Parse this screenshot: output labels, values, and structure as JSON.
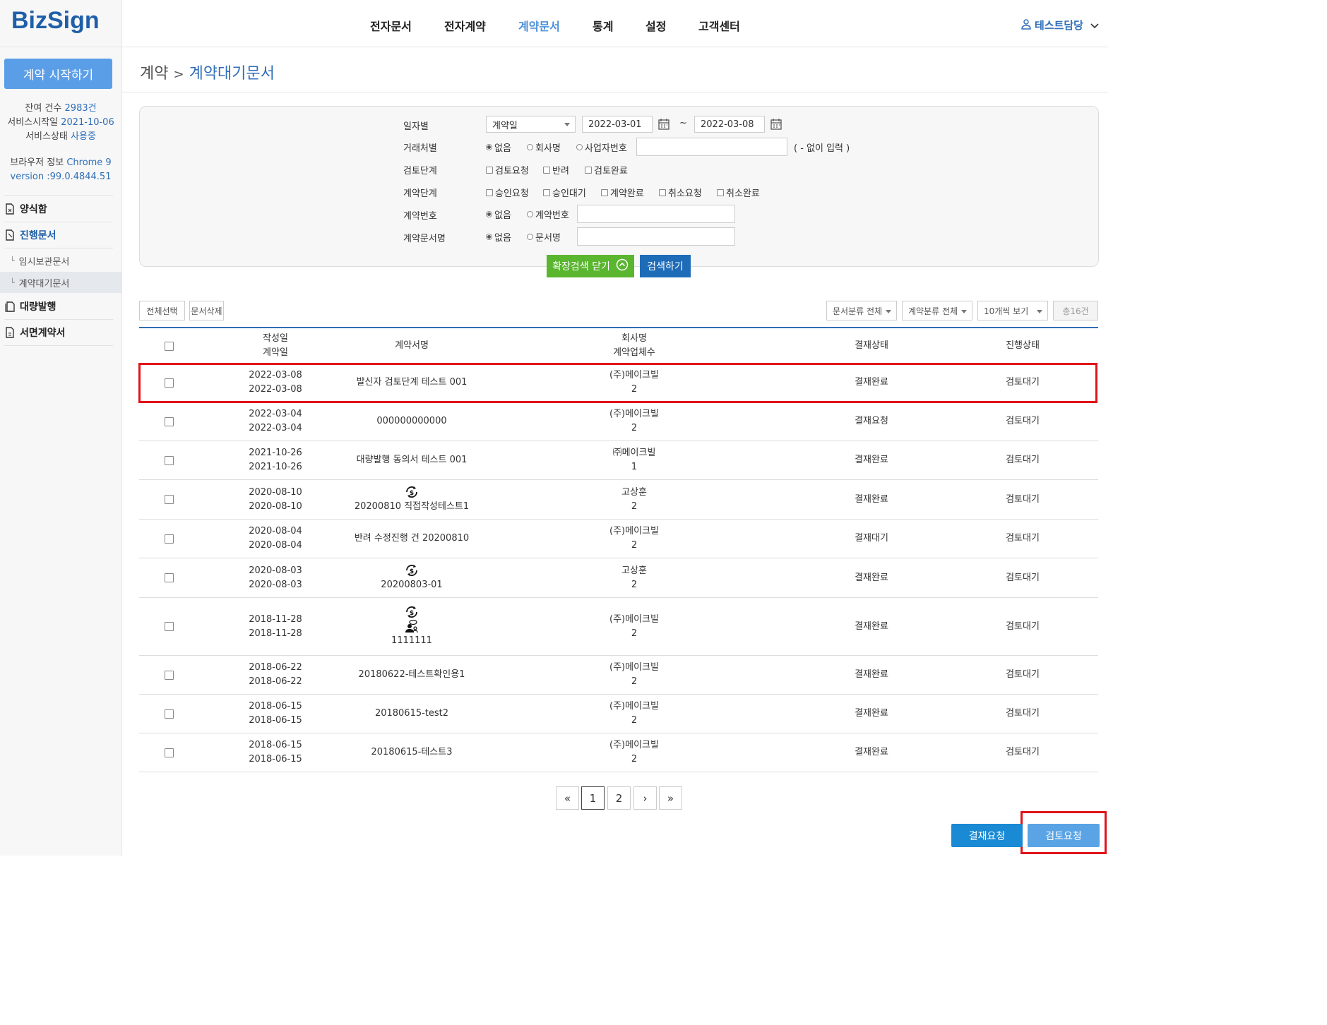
{
  "app": {
    "logo": "BizSign"
  },
  "topnav": {
    "items": [
      "전자문서",
      "전자계약",
      "계약문서",
      "통계",
      "설정",
      "고객센터"
    ],
    "active": "계약문서",
    "user": "테스트담당"
  },
  "sidebar": {
    "start_button": "계약 시작하기",
    "remaining_label": "잔여 건수",
    "remaining_value": "2983건",
    "service_start_label": "서비스시작일",
    "service_start_value": "2021-10-06",
    "service_status_label": "서비스상태",
    "service_status_value": "사용중",
    "browser_label": "브라우저 정보",
    "browser_value": "Chrome 9",
    "version_label": "version :",
    "version_value": "99.0.4844.51",
    "nav": [
      {
        "label": "양식함"
      },
      {
        "label": "진행문서"
      },
      {
        "label": "임시보관문서"
      },
      {
        "label": "계약대기문서"
      },
      {
        "label": "대량발행"
      },
      {
        "label": "서면계약서"
      }
    ]
  },
  "page": {
    "breadcrumb_parent": "계약",
    "breadcrumb_sep": ">",
    "breadcrumb_current": "계약대기문서"
  },
  "search": {
    "date_label": "일자별",
    "date_type": "계약일",
    "date_from": "2022-03-01",
    "date_tilde": "~",
    "date_to": "2022-03-08",
    "partner_label": "거래처별",
    "partner_options": [
      "없음",
      "회사명",
      "사업자번호"
    ],
    "partner_hint": "( - 없이 입력 )",
    "review_label": "검토단계",
    "review_options": [
      "검토요청",
      "반려",
      "검토완료"
    ],
    "contract_label": "계약단계",
    "contract_options": [
      "승인요청",
      "승인대기",
      "계약완료",
      "취소요청",
      "취소완료"
    ],
    "number_label": "계약번호",
    "number_options": [
      "없음",
      "계약번호"
    ],
    "docname_label": "계약문서명",
    "docname_options": [
      "없음",
      "문서명"
    ],
    "collapse_button": "확장검색 닫기",
    "search_button": "검색하기"
  },
  "toolbar": {
    "select_all": "전체선택",
    "delete": "문서삭제",
    "doc_type": "문서분류 전체",
    "contract_type": "계약분류 전체",
    "per_page": "10개씩 보기",
    "total": "총16건"
  },
  "table": {
    "headers": {
      "date1": "작성일",
      "date2": "계약일",
      "name": "계약서명",
      "company1": "회사명",
      "company2": "계약업체수",
      "approval": "결재상태",
      "progress": "진행상태"
    },
    "rows": [
      {
        "created": "2022-03-08",
        "contracted": "2022-03-08",
        "name": "발신자 검토단계 테스트 001",
        "company": "(주)메이크빌",
        "count": "2",
        "approval": "결재완료",
        "status": "검토대기",
        "icons": []
      },
      {
        "created": "2022-03-04",
        "contracted": "2022-03-04",
        "name": "000000000000",
        "company": "(주)메이크빌",
        "count": "2",
        "approval": "결재요청",
        "status": "검토대기",
        "icons": []
      },
      {
        "created": "2021-10-26",
        "contracted": "2021-10-26",
        "name": "대량발행 동의서 테스트 001",
        "company": "㈜메이크빌",
        "count": "1",
        "approval": "결재완료",
        "status": "검토대기",
        "icons": []
      },
      {
        "created": "2020-08-10",
        "contracted": "2020-08-10",
        "name": "20200810 직접작성테스트1",
        "company": "고상훈",
        "count": "2",
        "approval": "결재완료",
        "status": "검토대기",
        "icons": [
          "payment-cycle-icon"
        ]
      },
      {
        "created": "2020-08-04",
        "contracted": "2020-08-04",
        "name": "반려 수정진행 건 20200810",
        "company": "(주)메이크빌",
        "count": "2",
        "approval": "결재대기",
        "status": "검토대기",
        "icons": []
      },
      {
        "created": "2020-08-03",
        "contracted": "2020-08-03",
        "name": "20200803-01",
        "company": "고상훈",
        "count": "2",
        "approval": "결재완료",
        "status": "검토대기",
        "icons": [
          "payment-cycle-icon"
        ]
      },
      {
        "created": "2018-11-28",
        "contracted": "2018-11-28",
        "name": "1111111",
        "company": "(주)메이크빌",
        "count": "2",
        "approval": "결재완료",
        "status": "검토대기",
        "icons": [
          "payment-cycle-icon",
          "user-chat-icon"
        ]
      },
      {
        "created": "2018-06-22",
        "contracted": "2018-06-22",
        "name": "20180622-테스트확인용1",
        "company": "(주)메이크빌",
        "count": "2",
        "approval": "결재완료",
        "status": "검토대기",
        "icons": []
      },
      {
        "created": "2018-06-15",
        "contracted": "2018-06-15",
        "name": "20180615-test2",
        "company": "(주)메이크빌",
        "count": "2",
        "approval": "결재완료",
        "status": "검토대기",
        "icons": []
      },
      {
        "created": "2018-06-15",
        "contracted": "2018-06-15",
        "name": "20180615-테스트3",
        "company": "(주)메이크빌",
        "count": "2",
        "approval": "결재완료",
        "status": "검토대기",
        "icons": []
      }
    ]
  },
  "pagination": {
    "first": "«",
    "pages": [
      "1",
      "2"
    ],
    "current": "1",
    "next": "›",
    "last": "»"
  },
  "actions": {
    "approval_request": "결재요청",
    "review_request": "검토요청"
  },
  "colors": {
    "brand": "#1f5fa8",
    "accent": "#5b9ee8",
    "highlight": "#e0141b",
    "green": "#5ab52f",
    "blue_btn": "#1e6bb8",
    "approval_btn": "#1a8ad4",
    "review_btn": "#5aa4e6"
  }
}
